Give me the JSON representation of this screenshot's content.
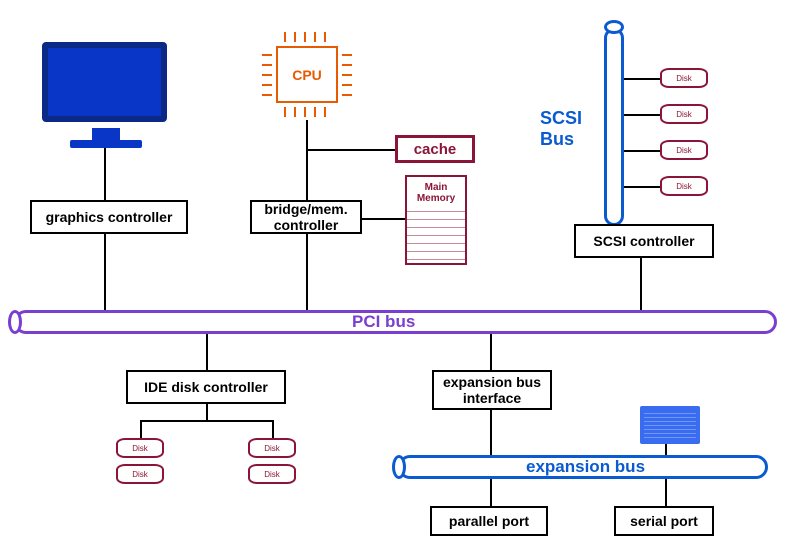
{
  "components": {
    "cpu": "CPU",
    "cache": "cache",
    "main_memory": "Main Memory",
    "graphics_controller": "graphics controller",
    "bridge_mem_controller": "bridge/mem. controller",
    "scsi_controller": "SCSI controller",
    "scsi_bus": "SCSI Bus",
    "pci_bus": "PCI bus",
    "ide_disk_controller": "IDE disk controller",
    "expansion_bus_interface": "expansion bus interface",
    "expansion_bus": "expansion bus",
    "parallel_port": "parallel port",
    "serial_port": "serial port",
    "disk": "Disk"
  },
  "colors": {
    "blue": "#0a5bd1",
    "maroon": "#8b1538",
    "orange": "#e85a00",
    "purple": "#7a3fd1",
    "monitor": "#0a36c7"
  },
  "icons": {
    "monitor": "monitor-icon",
    "cpu_chip": "cpu-chip-icon",
    "disk_cylinder": "disk-icon",
    "keyboard": "keyboard-icon"
  }
}
